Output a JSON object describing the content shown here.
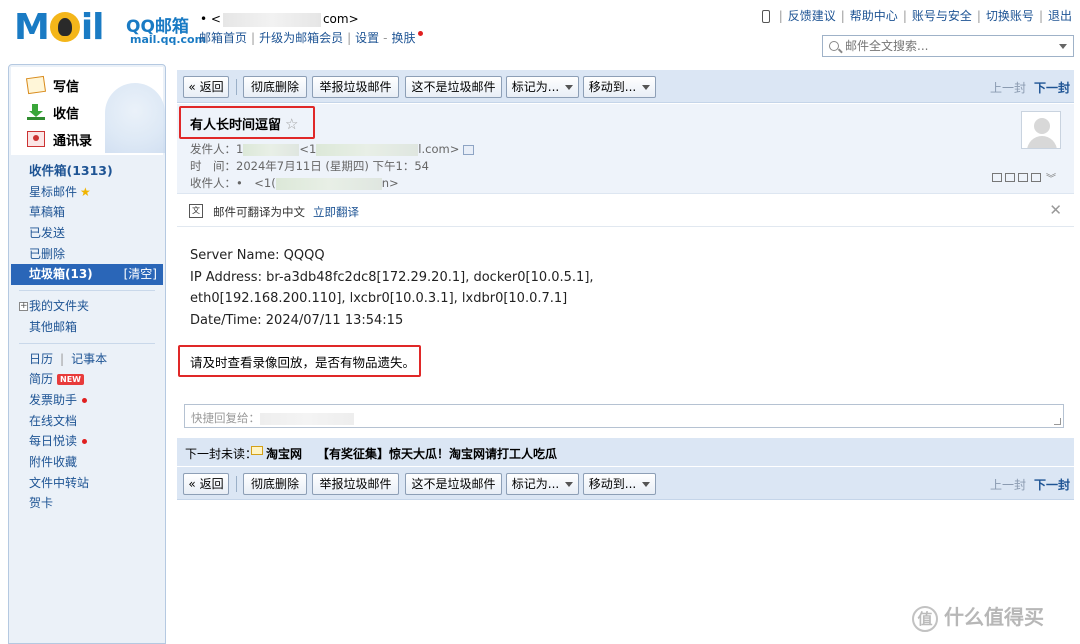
{
  "header": {
    "logo_main": "M",
    "logo_tail": "il",
    "logo_qq": "QQ邮箱",
    "logo_domain": "mail.qq.com",
    "account_prefix": "• <",
    "account_suffix": "com>",
    "nav": [
      "邮箱首页",
      "升级为邮箱会员",
      "设置",
      "换肤"
    ],
    "right_links": [
      "反馈建议",
      "帮助中心",
      "账号与安全",
      "切换账号",
      "退出"
    ],
    "search_placeholder": "邮件全文搜索..."
  },
  "sidebar": {
    "actions": [
      "写信",
      "收信",
      "通讯录"
    ],
    "folders": {
      "inbox": "收件箱(1313)",
      "starred": "星标邮件",
      "drafts": "草稿箱",
      "sent": "已发送",
      "deleted": "已删除",
      "spam": "垃圾箱(13)",
      "spam_clear": "[清空]",
      "my_folders": "我的文件夹",
      "other_mail": "其他邮箱",
      "calendar": "日历",
      "notes": "记事本",
      "resume": "简历",
      "resume_badge": "NEW",
      "invoice": "发票助手",
      "docs": "在线文档",
      "daily": "每日悦读",
      "attachments": "附件收藏",
      "transfer": "文件中转站",
      "cards": "贺卡"
    }
  },
  "toolbar": {
    "back": "« 返回",
    "delete": "彻底删除",
    "report": "举报垃圾邮件",
    "not_spam": "这不是垃圾邮件",
    "mark_as": "标记为...",
    "move_to": "移动到...",
    "prev": "上一封",
    "next": "下一封"
  },
  "mail": {
    "subject": "有人长时间逗留",
    "from_label": "发件人：",
    "from_start": "1",
    "from_mid": "<1",
    "from_end": "l.com>",
    "time_label": "时　间：",
    "time_value": "2024年7月11日 (星期四) 下午1：54",
    "to_label": "收件人：",
    "to_start": "•　<1(",
    "to_end": "n>",
    "translate_text": "邮件可翻译为中文",
    "translate_link": "立即翻译",
    "body_lines": [
      "Server Name: QQQQ",
      "IP Address: br-a3db48fc2dc8[172.29.20.1], docker0[10.0.5.1],",
      "eth0[192.168.200.110], lxcbr0[10.0.3.1], lxdbr0[10.0.7.1]",
      "Date/Time: 2024/07/11 13:54:15"
    ],
    "notice": "请及时查看录像回放，是否有物品遗失。",
    "reply_placeholder": "快捷回复给："
  },
  "next_unread": {
    "label": "下一封未读：",
    "sender": "淘宝网",
    "subject": "【有奖征集】惊天大瓜！淘宝网请打工人吃瓜"
  },
  "watermark": "值 什么值得买",
  "colors": {
    "accent": "#1e5494",
    "highlight_box": "#e02828",
    "toolbar_bg": "#dbe6f4",
    "active_folder": "#2a66b8"
  }
}
